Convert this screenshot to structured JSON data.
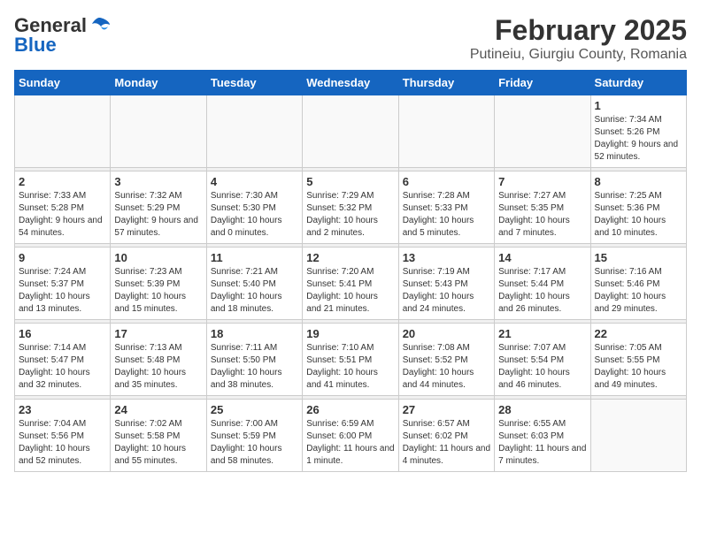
{
  "logo": {
    "general": "General",
    "blue": "Blue",
    "tagline": "GeneralBlue"
  },
  "title": "February 2025",
  "subtitle": "Putineiu, Giurgiu County, Romania",
  "weekdays": [
    "Sunday",
    "Monday",
    "Tuesday",
    "Wednesday",
    "Thursday",
    "Friday",
    "Saturday"
  ],
  "weeks": [
    [
      {
        "day": "",
        "detail": ""
      },
      {
        "day": "",
        "detail": ""
      },
      {
        "day": "",
        "detail": ""
      },
      {
        "day": "",
        "detail": ""
      },
      {
        "day": "",
        "detail": ""
      },
      {
        "day": "",
        "detail": ""
      },
      {
        "day": "1",
        "detail": "Sunrise: 7:34 AM\nSunset: 5:26 PM\nDaylight: 9 hours and 52 minutes."
      }
    ],
    [
      {
        "day": "2",
        "detail": "Sunrise: 7:33 AM\nSunset: 5:28 PM\nDaylight: 9 hours and 54 minutes."
      },
      {
        "day": "3",
        "detail": "Sunrise: 7:32 AM\nSunset: 5:29 PM\nDaylight: 9 hours and 57 minutes."
      },
      {
        "day": "4",
        "detail": "Sunrise: 7:30 AM\nSunset: 5:30 PM\nDaylight: 10 hours and 0 minutes."
      },
      {
        "day": "5",
        "detail": "Sunrise: 7:29 AM\nSunset: 5:32 PM\nDaylight: 10 hours and 2 minutes."
      },
      {
        "day": "6",
        "detail": "Sunrise: 7:28 AM\nSunset: 5:33 PM\nDaylight: 10 hours and 5 minutes."
      },
      {
        "day": "7",
        "detail": "Sunrise: 7:27 AM\nSunset: 5:35 PM\nDaylight: 10 hours and 7 minutes."
      },
      {
        "day": "8",
        "detail": "Sunrise: 7:25 AM\nSunset: 5:36 PM\nDaylight: 10 hours and 10 minutes."
      }
    ],
    [
      {
        "day": "9",
        "detail": "Sunrise: 7:24 AM\nSunset: 5:37 PM\nDaylight: 10 hours and 13 minutes."
      },
      {
        "day": "10",
        "detail": "Sunrise: 7:23 AM\nSunset: 5:39 PM\nDaylight: 10 hours and 15 minutes."
      },
      {
        "day": "11",
        "detail": "Sunrise: 7:21 AM\nSunset: 5:40 PM\nDaylight: 10 hours and 18 minutes."
      },
      {
        "day": "12",
        "detail": "Sunrise: 7:20 AM\nSunset: 5:41 PM\nDaylight: 10 hours and 21 minutes."
      },
      {
        "day": "13",
        "detail": "Sunrise: 7:19 AM\nSunset: 5:43 PM\nDaylight: 10 hours and 24 minutes."
      },
      {
        "day": "14",
        "detail": "Sunrise: 7:17 AM\nSunset: 5:44 PM\nDaylight: 10 hours and 26 minutes."
      },
      {
        "day": "15",
        "detail": "Sunrise: 7:16 AM\nSunset: 5:46 PM\nDaylight: 10 hours and 29 minutes."
      }
    ],
    [
      {
        "day": "16",
        "detail": "Sunrise: 7:14 AM\nSunset: 5:47 PM\nDaylight: 10 hours and 32 minutes."
      },
      {
        "day": "17",
        "detail": "Sunrise: 7:13 AM\nSunset: 5:48 PM\nDaylight: 10 hours and 35 minutes."
      },
      {
        "day": "18",
        "detail": "Sunrise: 7:11 AM\nSunset: 5:50 PM\nDaylight: 10 hours and 38 minutes."
      },
      {
        "day": "19",
        "detail": "Sunrise: 7:10 AM\nSunset: 5:51 PM\nDaylight: 10 hours and 41 minutes."
      },
      {
        "day": "20",
        "detail": "Sunrise: 7:08 AM\nSunset: 5:52 PM\nDaylight: 10 hours and 44 minutes."
      },
      {
        "day": "21",
        "detail": "Sunrise: 7:07 AM\nSunset: 5:54 PM\nDaylight: 10 hours and 46 minutes."
      },
      {
        "day": "22",
        "detail": "Sunrise: 7:05 AM\nSunset: 5:55 PM\nDaylight: 10 hours and 49 minutes."
      }
    ],
    [
      {
        "day": "23",
        "detail": "Sunrise: 7:04 AM\nSunset: 5:56 PM\nDaylight: 10 hours and 52 minutes."
      },
      {
        "day": "24",
        "detail": "Sunrise: 7:02 AM\nSunset: 5:58 PM\nDaylight: 10 hours and 55 minutes."
      },
      {
        "day": "25",
        "detail": "Sunrise: 7:00 AM\nSunset: 5:59 PM\nDaylight: 10 hours and 58 minutes."
      },
      {
        "day": "26",
        "detail": "Sunrise: 6:59 AM\nSunset: 6:00 PM\nDaylight: 11 hours and 1 minute."
      },
      {
        "day": "27",
        "detail": "Sunrise: 6:57 AM\nSunset: 6:02 PM\nDaylight: 11 hours and 4 minutes."
      },
      {
        "day": "28",
        "detail": "Sunrise: 6:55 AM\nSunset: 6:03 PM\nDaylight: 11 hours and 7 minutes."
      },
      {
        "day": "",
        "detail": ""
      }
    ]
  ]
}
